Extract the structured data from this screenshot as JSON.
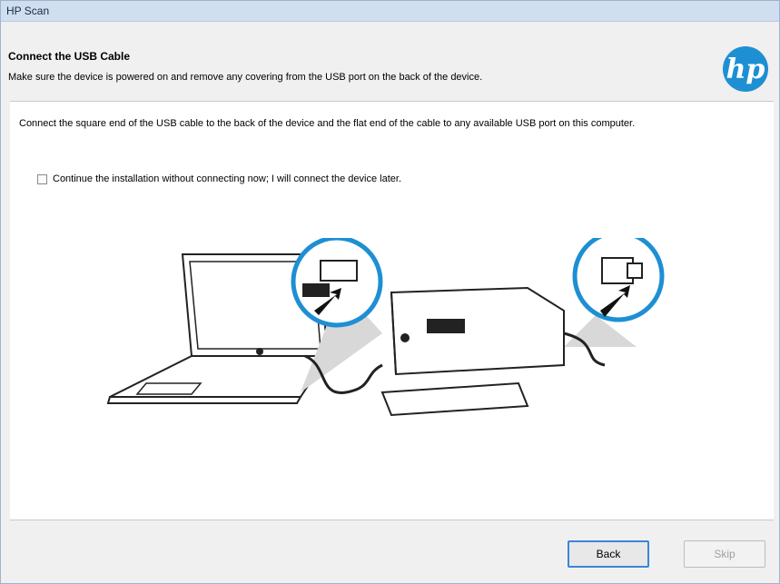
{
  "window": {
    "title": "HP Scan"
  },
  "header": {
    "title": "Connect the USB Cable",
    "subtitle": "Make sure the device is powered on and remove any covering from the USB port on the back of the device.",
    "logo_text": "hp"
  },
  "content": {
    "instruction": "Connect the square end of the USB cable to the back of the device and the flat end of the cable to any available USB port on this computer.",
    "checkbox": {
      "label": "Continue the installation without connecting now; I will connect the device later.",
      "checked": false
    }
  },
  "footer": {
    "back_label": "Back",
    "skip_label": "Skip"
  },
  "colors": {
    "brand": "#1e8fd3",
    "focus": "#3a86d6"
  }
}
